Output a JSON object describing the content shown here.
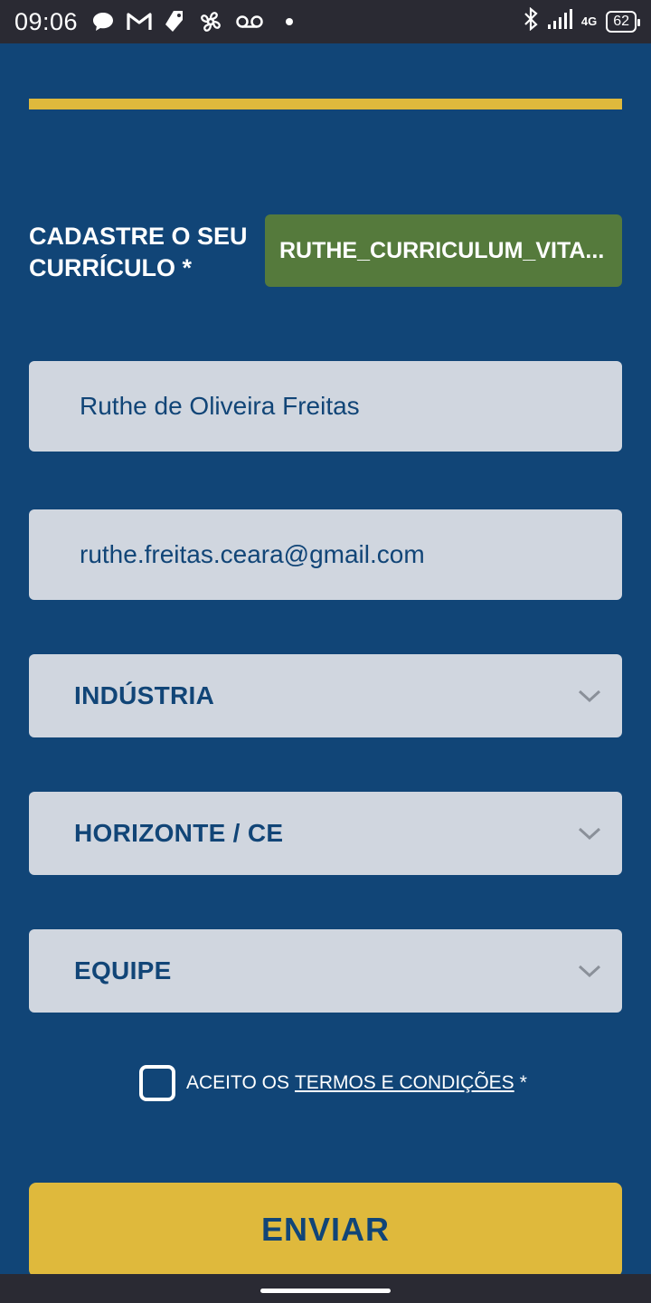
{
  "status_bar": {
    "time": "09:06",
    "network": "4G",
    "battery": "62",
    "icons": [
      "chat-bubble-icon",
      "gmail-icon",
      "tag-icon",
      "pinwheel-icon",
      "voicemail-icon",
      "bluetooth-icon",
      "signal-icon"
    ]
  },
  "form": {
    "cv_label": "CADASTRE O SEU CURRÍCULO *",
    "cv_file": "RUTHE_CURRICULUM_VITA...",
    "name_value": "Ruthe de Oliveira Freitas",
    "email_value": "ruthe.freitas.ceara@gmail.com",
    "select_area": "INDÚSTRIA",
    "select_city": "HORIZONTE / CE",
    "select_team": "EQUIPE",
    "terms_prefix": "ACEITO OS",
    "terms_link": "TERMOS E CONDIÇÕES",
    "terms_suffix": "*",
    "terms_checked": false,
    "submit_label": "ENVIAR"
  },
  "colors": {
    "background": "#114577",
    "accent": "#dfb93c",
    "file_button": "#557a3c",
    "field": "#d0d6df"
  }
}
